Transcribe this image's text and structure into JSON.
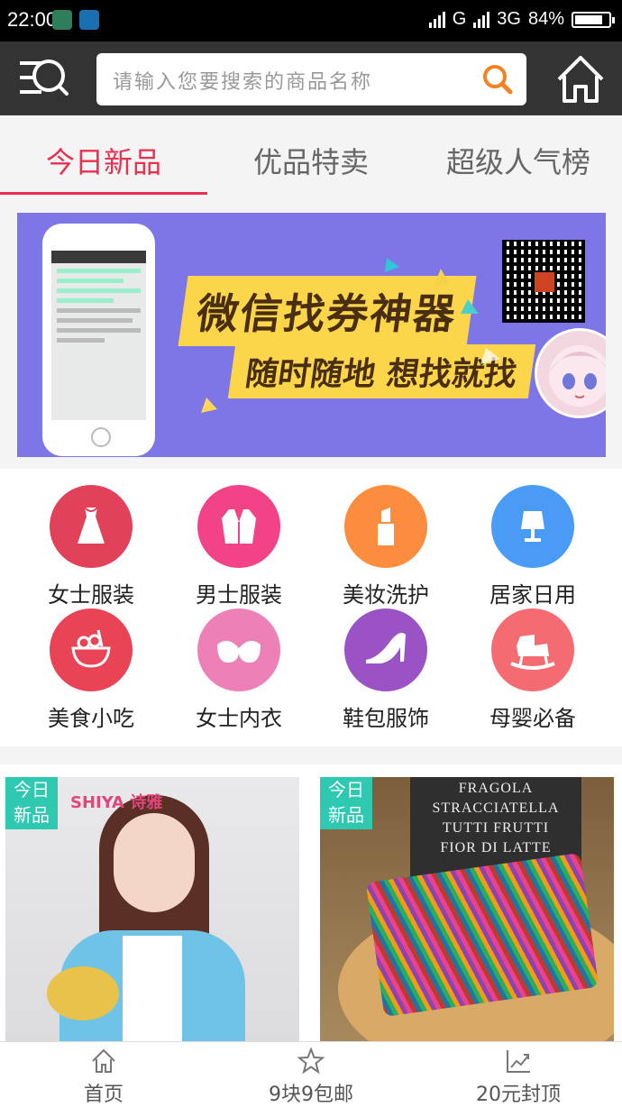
{
  "status_bar": {
    "time": "22:00",
    "network1": "G",
    "network2": "3G",
    "battery": "84%",
    "battery_level": 0.84
  },
  "header": {
    "search_placeholder": "请输入您要搜索的商品名称"
  },
  "tabs": [
    {
      "label": "今日新品",
      "active": true
    },
    {
      "label": "优品特卖",
      "active": false
    },
    {
      "label": "超级人气榜",
      "active": false
    }
  ],
  "banner": {
    "line1": "微信找券神器",
    "line2": "随时随地 想找就找"
  },
  "categories": [
    {
      "label": "女士服装",
      "icon": "dress-icon",
      "color": "#e2415a"
    },
    {
      "label": "男士服装",
      "icon": "suit-icon",
      "color": "#f24388"
    },
    {
      "label": "美妆洗护",
      "icon": "lipstick-icon",
      "color": "#fc8d3e"
    },
    {
      "label": "居家日用",
      "icon": "lamp-icon",
      "color": "#4a9bf5"
    },
    {
      "label": "美食小吃",
      "icon": "food-bowl-icon",
      "color": "#e94455"
    },
    {
      "label": "女士内衣",
      "icon": "bra-icon",
      "color": "#ee80b8"
    },
    {
      "label": "鞋包服饰",
      "icon": "high-heel-icon",
      "color": "#9a52c4"
    },
    {
      "label": "母婴必备",
      "icon": "rocking-horse-icon",
      "color": "#f46c72"
    }
  ],
  "products": [
    {
      "badge_line1": "今日",
      "badge_line2": "新品",
      "brand_text": "SHIYA 诗雅"
    },
    {
      "badge_line1": "今日",
      "badge_line2": "新品",
      "sign_text": [
        "FRAGOLA",
        "STRACCIATELLA",
        "TUTTI FRUTTI",
        "FIOR DI LATTE"
      ]
    }
  ],
  "bottom_nav": [
    {
      "label": "首页",
      "icon": "home-icon"
    },
    {
      "label": "9块9包邮",
      "icon": "star-icon"
    },
    {
      "label": "20元封顶",
      "icon": "trend-chart-icon"
    }
  ]
}
